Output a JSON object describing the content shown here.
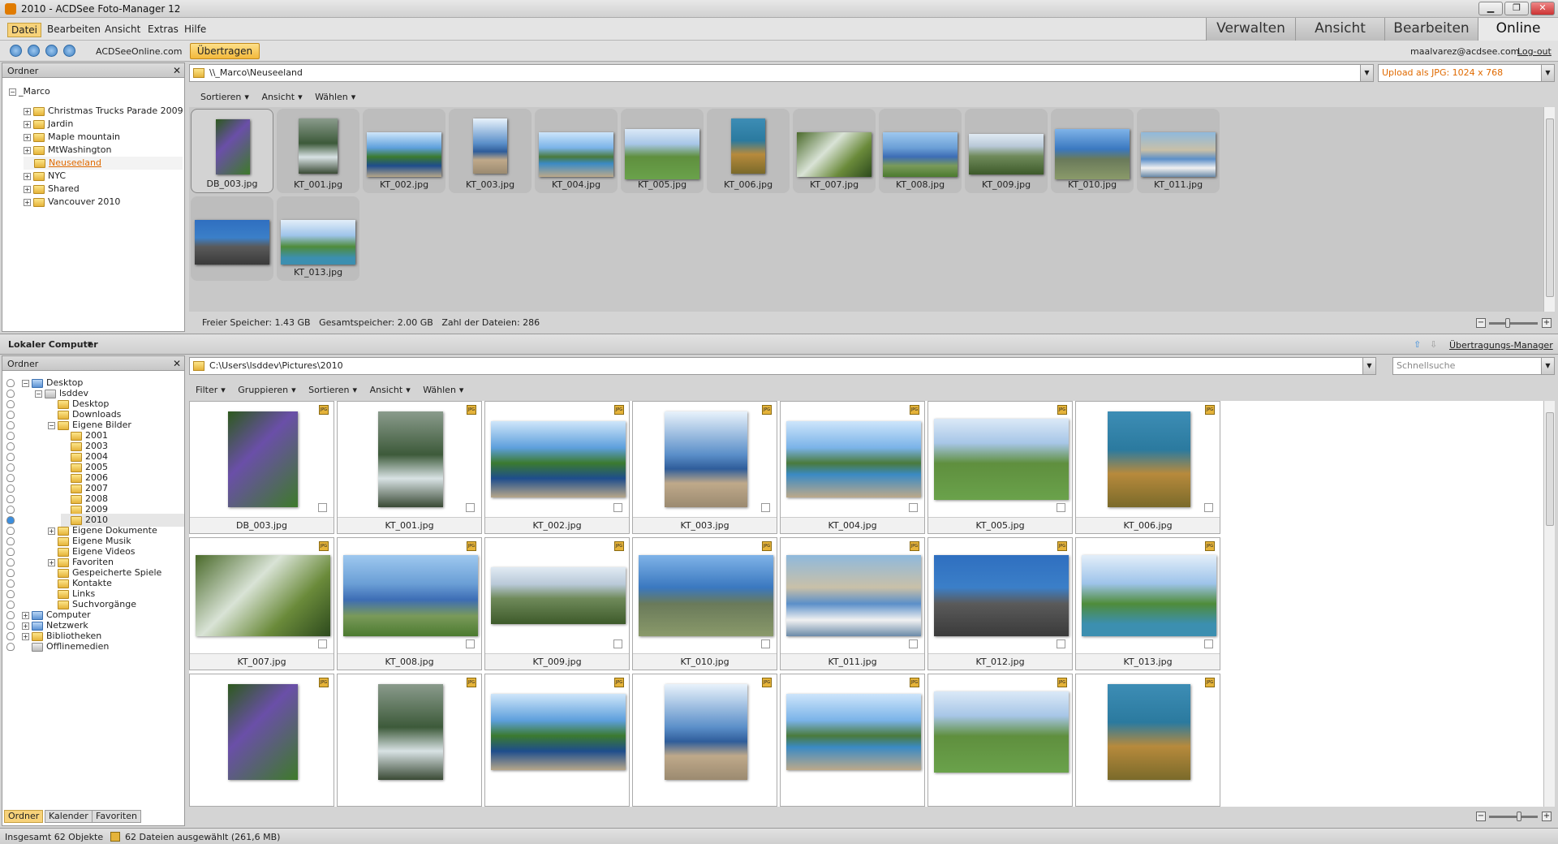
{
  "window": {
    "title": "2010 - ACDSee Foto-Manager 12",
    "controls": [
      "▁",
      "❐",
      "✕"
    ]
  },
  "menu": [
    "Datei",
    "Bearbeiten",
    "Ansicht",
    "Extras",
    "Hilfe"
  ],
  "modes": [
    "Verwalten",
    "Ansicht",
    "Bearbeiten",
    "Online"
  ],
  "toolbar": {
    "site": "ACDSeeOnline.com",
    "upload": "Übertragen",
    "user": "maalvarez@acdsee.com",
    "logout": "Log-out"
  },
  "top": {
    "folder_header": "Ordner",
    "tree": [
      {
        "label": "_Marco"
      },
      {
        "label": "Christmas Trucks Parade 2009"
      },
      {
        "label": "Jardin"
      },
      {
        "label": "Maple mountain"
      },
      {
        "label": "MtWashington"
      },
      {
        "label": "Neuseeland"
      },
      {
        "label": "NYC"
      },
      {
        "label": "Shared"
      },
      {
        "label": "Vancouver 2010"
      }
    ],
    "path": "\\\\_Marco\\Neuseeland",
    "upload_format": "Upload als JPG: 1024 x 768",
    "tools": [
      "Sortieren",
      "Ansicht",
      "Wählen"
    ],
    "files": [
      "DB_003.jpg",
      "KT_001.jpg",
      "KT_002.jpg",
      "KT_003.jpg",
      "KT_004.jpg",
      "KT_005.jpg",
      "KT_006.jpg",
      "KT_007.jpg",
      "KT_008.jpg",
      "KT_009.jpg",
      "KT_010.jpg",
      "KT_011.jpg",
      "",
      "KT_013.jpg"
    ],
    "status": {
      "free": "Freier Speicher: 1.43 GB",
      "total": "Gesamtspeicher: 2.00 GB",
      "count": "Zahl der Dateien: 286"
    }
  },
  "bottom": {
    "computer_label": "Lokaler Computer",
    "transfer_manager": "Übertragungs-Manager",
    "folder_header": "Ordner",
    "tree": [
      {
        "label": "Desktop"
      },
      {
        "label": "lsddev"
      },
      {
        "label": "Desktop"
      },
      {
        "label": "Downloads"
      },
      {
        "label": "Eigene Bilder"
      },
      {
        "label": "2001"
      },
      {
        "label": "2003"
      },
      {
        "label": "2004"
      },
      {
        "label": "2005"
      },
      {
        "label": "2006"
      },
      {
        "label": "2007"
      },
      {
        "label": "2008"
      },
      {
        "label": "2009"
      },
      {
        "label": "2010"
      },
      {
        "label": "Eigene Dokumente"
      },
      {
        "label": "Eigene Musik"
      },
      {
        "label": "Eigene Videos"
      },
      {
        "label": "Favoriten"
      },
      {
        "label": "Gespeicherte Spiele"
      },
      {
        "label": "Kontakte"
      },
      {
        "label": "Links"
      },
      {
        "label": "Suchvorgänge"
      },
      {
        "label": "Computer"
      },
      {
        "label": "Netzwerk"
      },
      {
        "label": "Bibliotheken"
      },
      {
        "label": "Offlinemedien"
      }
    ],
    "path": "C:\\Users\\lsddev\\Pictures\\2010",
    "search_placeholder": "Schnellsuche",
    "tools": [
      "Filter",
      "Gruppieren",
      "Sortieren",
      "Ansicht",
      "Wählen"
    ],
    "jpg_badge": "JPG",
    "files": [
      "DB_003.jpg",
      "KT_001.jpg",
      "KT_002.jpg",
      "KT_003.jpg",
      "KT_004.jpg",
      "KT_005.jpg",
      "KT_006.jpg",
      "KT_007.jpg",
      "KT_008.jpg",
      "KT_009.jpg",
      "KT_010.jpg",
      "KT_011.jpg",
      "KT_012.jpg",
      "KT_013.jpg"
    ],
    "tabs": [
      "Ordner",
      "Kalender",
      "Favoriten"
    ]
  },
  "statusbar": {
    "total": "Insgesamt 62 Objekte",
    "selected": "62 Dateien ausgewählt (261,6 MB)"
  },
  "colors": {
    "accent": "#f3b83b",
    "link_orange": "#e06a00"
  }
}
